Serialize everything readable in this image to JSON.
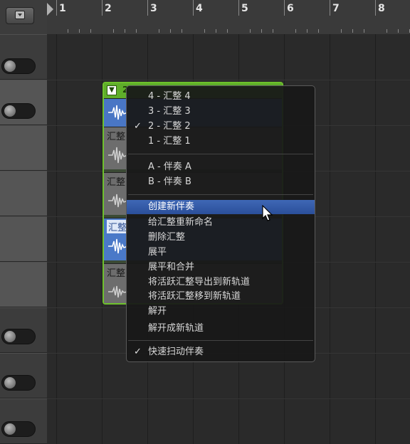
{
  "ruler": {
    "bars": [
      "1",
      "2",
      "3",
      "4",
      "5",
      "6",
      "7",
      "8"
    ]
  },
  "region": {
    "header_number": "2",
    "take_label": "汇整"
  },
  "context_menu": {
    "items": [
      {
        "label": "4 - 汇整 4",
        "checked": false
      },
      {
        "label": "3 - 汇整 3",
        "checked": false
      },
      {
        "label": "2 - 汇整 2",
        "checked": true
      },
      {
        "label": "1 - 汇整 1",
        "checked": false
      },
      {
        "label": "A - 伴奏 A",
        "checked": false
      },
      {
        "label": "B - 伴奏 B",
        "checked": false
      },
      {
        "label": "创建新伴奏",
        "checked": false,
        "highlighted": true
      },
      {
        "label": "给汇整重新命名",
        "checked": false
      },
      {
        "label": "删除汇整",
        "checked": false
      },
      {
        "label": "展平",
        "checked": false
      },
      {
        "label": "展平和合并",
        "checked": false
      },
      {
        "label": "将活跃汇整导出到新轨道",
        "checked": false
      },
      {
        "label": "将活跃汇整移到新轨道",
        "checked": false
      },
      {
        "label": "解开",
        "checked": false
      },
      {
        "label": "解开成新轨道",
        "checked": false
      },
      {
        "label": "快速扫动伴奏",
        "checked": true
      }
    ],
    "checkmark": "✓"
  },
  "colors": {
    "accent": "#6ec12c",
    "highlight": "#2f559f",
    "take_active": "#4976c5"
  }
}
